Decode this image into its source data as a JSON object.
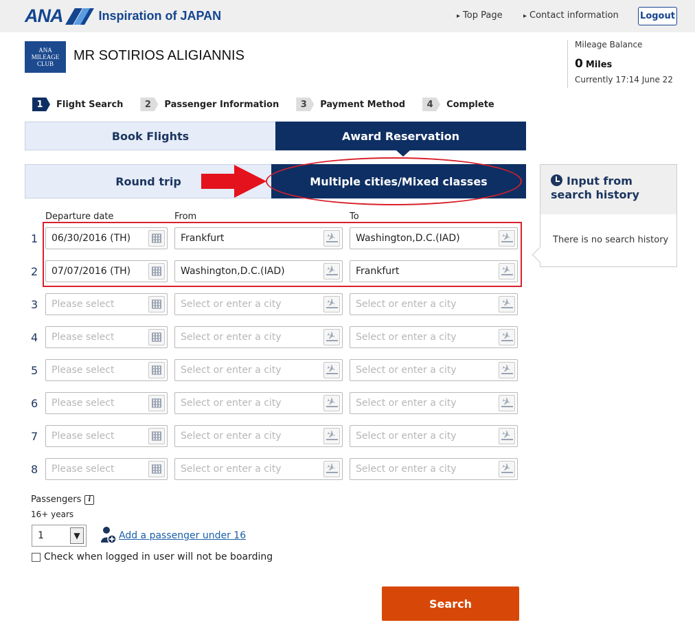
{
  "header": {
    "logo_text": "ANA",
    "tagline": "Inspiration of JAPAN",
    "top_page": "Top Page",
    "contact": "Contact information",
    "logout": "Logout"
  },
  "member": {
    "club_badge": "ANA MILEAGE CLUB",
    "name": "MR SOTIRIOS ALIGIANNIS",
    "mileage_title": "Mileage Balance",
    "mileage_value": "0",
    "mileage_unit": "Miles",
    "mileage_time": "Currently 17:14 June 22"
  },
  "steps": [
    {
      "num": "1",
      "label": "Flight Search"
    },
    {
      "num": "2",
      "label": "Passenger Information"
    },
    {
      "num": "3",
      "label": "Payment Method"
    },
    {
      "num": "4",
      "label": "Complete"
    }
  ],
  "tabs": {
    "book_flights": "Book Flights",
    "award_reservation": "Award Reservation",
    "round_trip": "Round trip",
    "multiple_cities": "Multiple cities/Mixed classes"
  },
  "history": {
    "title": "Input from search history",
    "empty": "There is no search history"
  },
  "form": {
    "departure_label": "Departure date",
    "from_label": "From",
    "to_label": "To",
    "rows": [
      {
        "num": "1",
        "date": "06/30/2016 (TH)",
        "from": "Frankfurt",
        "to": "Washington,D.C.(IAD)"
      },
      {
        "num": "2",
        "date": "07/07/2016 (TH)",
        "from": "Washington,D.C.(IAD)",
        "to": "Frankfurt"
      },
      {
        "num": "3",
        "date": "",
        "from": "",
        "to": ""
      },
      {
        "num": "4",
        "date": "",
        "from": "",
        "to": ""
      },
      {
        "num": "5",
        "date": "",
        "from": "",
        "to": ""
      },
      {
        "num": "6",
        "date": "",
        "from": "",
        "to": ""
      },
      {
        "num": "7",
        "date": "",
        "from": "",
        "to": ""
      },
      {
        "num": "8",
        "date": "",
        "from": "",
        "to": ""
      }
    ],
    "date_placeholder": "Please select",
    "city_placeholder": "Select or enter a city"
  },
  "passengers": {
    "label": "Passengers",
    "age_label": "16+ years",
    "count": "1",
    "add_link": "Add a passenger under 16",
    "not_boarding": "Check when logged in user will not be boarding"
  },
  "search_button": "Search",
  "colors": {
    "brand_navy": "#0e2f63",
    "search_orange": "#d74808",
    "annotation_red": "#d9202a"
  }
}
